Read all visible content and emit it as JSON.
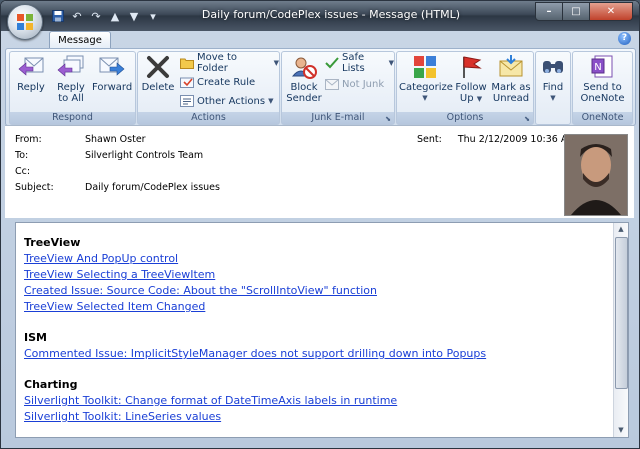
{
  "window": {
    "title": "Daily forum/CodePlex issues - Message (HTML)",
    "min_glyph": "–",
    "max_glyph": "□",
    "close_glyph": "✕"
  },
  "qat": {
    "undo_glyph": "↶",
    "redo_glyph": "↷",
    "up_glyph": "▲",
    "down_glyph": "▼",
    "customize_glyph": "▾"
  },
  "tabs": [
    {
      "label": "Message",
      "selected": true
    }
  ],
  "help_glyph": "?",
  "ribbon": {
    "respond": {
      "label": "Respond",
      "reply": "Reply",
      "reply_all_1": "Reply",
      "reply_all_2": "to All",
      "forward": "Forward"
    },
    "actions": {
      "label": "Actions",
      "delete": "Delete",
      "move_to_folder": "Move to Folder",
      "create_rule": "Create Rule",
      "other_actions": "Other Actions"
    },
    "junk": {
      "label": "Junk E-mail",
      "block_sender_1": "Block",
      "block_sender_2": "Sender",
      "safe_lists": "Safe Lists",
      "not_junk": "Not Junk"
    },
    "options": {
      "label": "Options",
      "categorize": "Categorize",
      "follow_up_1": "Follow",
      "follow_up_2": "Up",
      "mark_unread_1": "Mark as",
      "mark_unread_2": "Unread"
    },
    "find": {
      "label": "Find"
    },
    "onenote": {
      "label": "OneNote",
      "send_1": "Send to",
      "send_2": "OneNote"
    }
  },
  "header": {
    "from_label": "From:",
    "from": "Shawn Oster",
    "to_label": "To:",
    "to": "Silverlight Controls Team",
    "cc_label": "Cc:",
    "cc": "",
    "subject_label": "Subject:",
    "subject": "Daily forum/CodePlex issues",
    "sent_label": "Sent:",
    "sent": "Thu 2/12/2009 10:36 AM"
  },
  "body": {
    "sections": [
      {
        "title": "TreeView",
        "links": [
          "TreeView And PopUp control",
          "TreeView Selecting a TreeViewItem",
          "Created Issue: Source Code: About the \"ScrollIntoView\" function",
          "TreeView Selected Item Changed"
        ]
      },
      {
        "title": "ISM",
        "links": [
          "Commented Issue: ImplicitStyleManager does not support drilling down into Popups"
        ]
      },
      {
        "title": "Charting",
        "links": [
          "Silverlight Toolkit: Change format of DateTimeAxis labels in runtime",
          "Silverlight Toolkit: LineSeries values"
        ]
      }
    ]
  },
  "colors": {
    "link": "#1a3fd6",
    "ribbon_label": "#3e5578",
    "titlebar": "#3c4857"
  }
}
